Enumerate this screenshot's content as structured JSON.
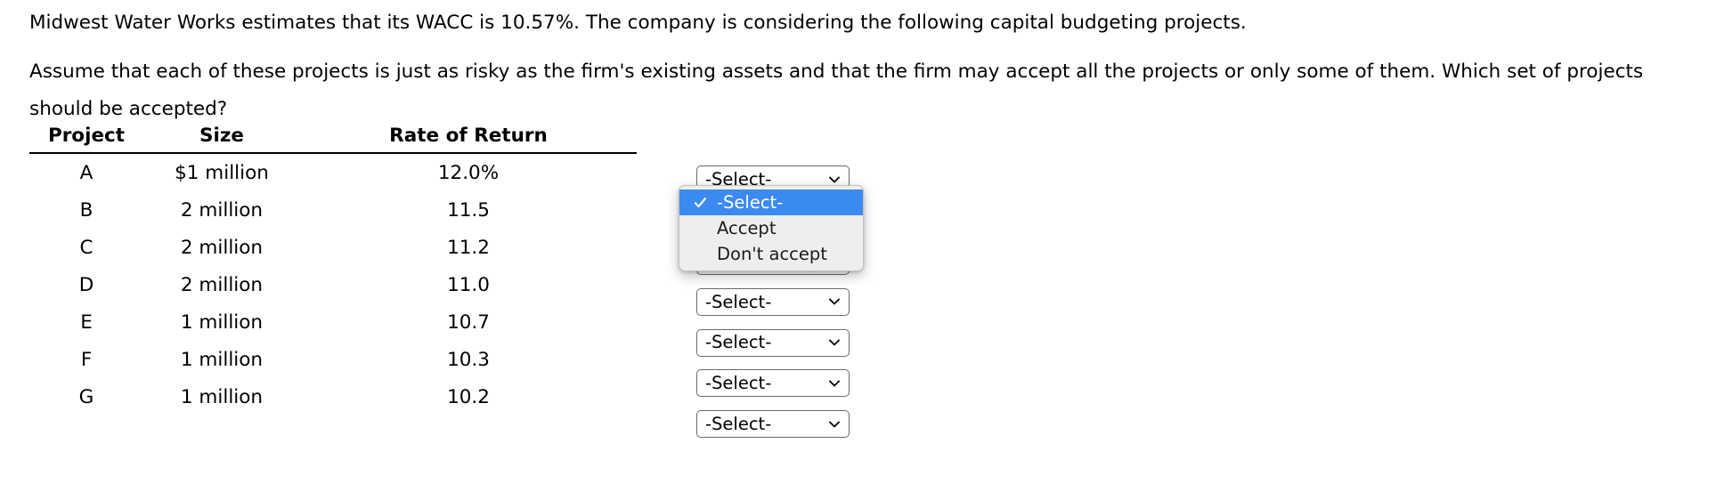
{
  "prompt": {
    "line1": "Midwest Water Works estimates that its WACC is 10.57%. The company is considering the following capital budgeting projects.",
    "line2": "Assume that each of these projects is just as risky as the firm's existing assets and that the firm may accept all the projects or only some of them. Which set of projects should be accepted?"
  },
  "table": {
    "headers": {
      "project": "Project",
      "size": "Size",
      "rate_of_return": "Rate of Return"
    },
    "rows": [
      {
        "project": "A",
        "size": "$1 million",
        "rate_of_return": "12.0%",
        "select_value": "-Select-"
      },
      {
        "project": "B",
        "size": "2 million",
        "rate_of_return": "11.5",
        "select_value": "-Select-"
      },
      {
        "project": "C",
        "size": "2 million",
        "rate_of_return": "11.2",
        "select_value": "-Select-"
      },
      {
        "project": "D",
        "size": "2 million",
        "rate_of_return": "11.0",
        "select_value": "-Select-"
      },
      {
        "project": "E",
        "size": "1 million",
        "rate_of_return": "10.7",
        "select_value": "-Select-"
      },
      {
        "project": "F",
        "size": "1 million",
        "rate_of_return": "10.3",
        "select_value": "-Select-"
      },
      {
        "project": "G",
        "size": "1 million",
        "rate_of_return": "10.2",
        "select_value": "-Select-"
      }
    ]
  },
  "dropdown": {
    "open": true,
    "open_for_row": "A",
    "selected_index": 0,
    "options": [
      {
        "label": "-Select-",
        "checked": true
      },
      {
        "label": "Accept",
        "checked": false
      },
      {
        "label": "Don't accept",
        "checked": false
      }
    ],
    "highlight_color": "#3b8aef",
    "panel_color": "#eeeeee",
    "checkmark_icon": "check-icon"
  },
  "icons": {
    "chevron": "chevron-down-icon",
    "check": "check-icon"
  }
}
